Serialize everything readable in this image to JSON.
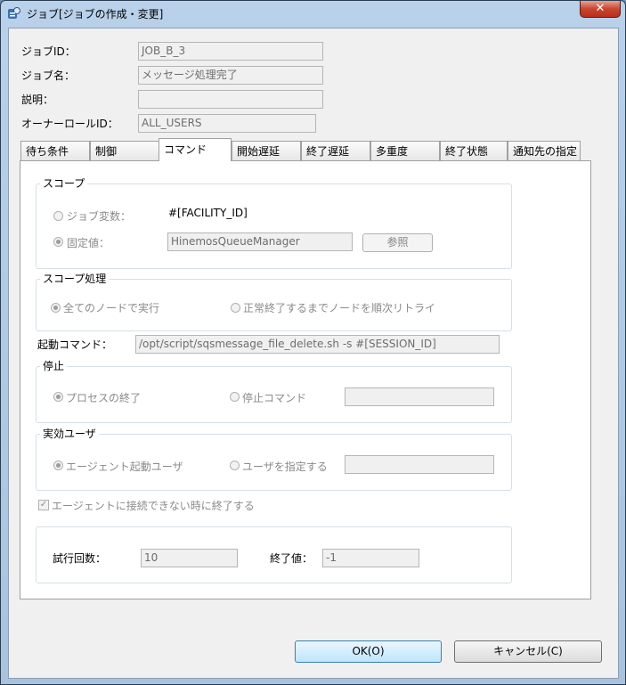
{
  "window": {
    "title": "ジョブ[ジョブの作成・変更]",
    "close_label": "✕"
  },
  "fields": {
    "job_id_label": "ジョブID：",
    "job_id_value": "JOB_B_3",
    "job_name_label": "ジョブ名：",
    "job_name_value": "メッセージ処理完了",
    "description_label": "説明：",
    "description_value": "",
    "owner_role_label": "オーナーロールID：",
    "owner_role_value": "ALL_USERS"
  },
  "tabs": [
    {
      "label": "待ち条件"
    },
    {
      "label": "制御"
    },
    {
      "label": "コマンド"
    },
    {
      "label": "開始遅延"
    },
    {
      "label": "終了遅延"
    },
    {
      "label": "多重度"
    },
    {
      "label": "終了状態"
    },
    {
      "label": "通知先の指定"
    }
  ],
  "active_tab": "コマンド",
  "scope": {
    "title": "スコープ",
    "job_variable_label": "ジョブ変数：",
    "job_variable_value": "#[FACILITY_ID]",
    "fixed_value_label": "固定値：",
    "fixed_value_value": "HinemosQueueManager",
    "browse_label": "参照"
  },
  "scope_processing": {
    "title": "スコープ処理",
    "all_nodes_label": "全てのノードで実行",
    "retry_label": "正常終了するまでノードを順次リトライ"
  },
  "start_command": {
    "label": "起動コマンド：",
    "value": "/opt/script/sqsmessage_file_delete.sh -s #[SESSION_ID]"
  },
  "stop": {
    "title": "停止",
    "process_end_label": "プロセスの終了",
    "stop_command_label": "停止コマンド",
    "stop_command_value": ""
  },
  "effective_user": {
    "title": "実効ユーザ",
    "agent_user_label": "エージェント起動ユーザ",
    "specify_user_label": "ユーザを指定する",
    "user_value": ""
  },
  "agent_check": {
    "label": "エージェントに接続できない時に終了する",
    "mark": "✓"
  },
  "retry": {
    "count_label": "試行回数：",
    "count_value": "10",
    "end_value_label": "終了値：",
    "end_value_value": "-1"
  },
  "buttons": {
    "ok": "OK(O)",
    "cancel": "キャンセル(C)"
  }
}
